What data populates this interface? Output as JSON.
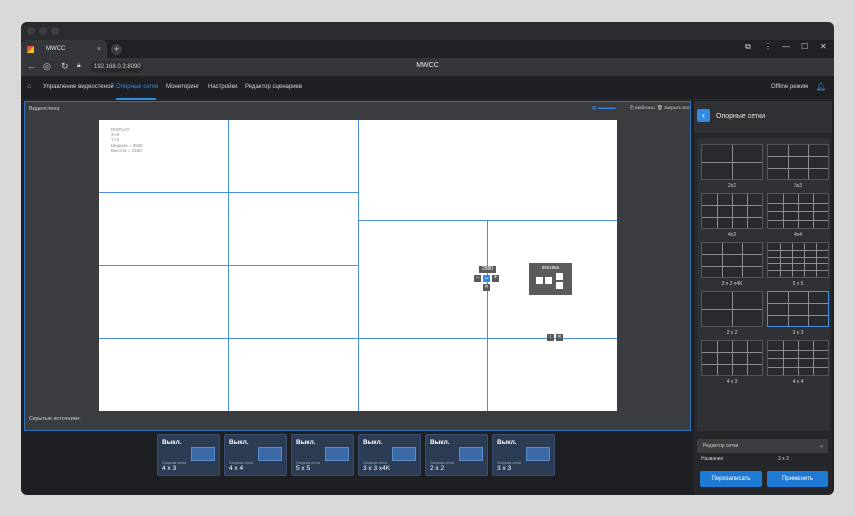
{
  "browser": {
    "tab_title": "MWCC",
    "new_tab": "+",
    "url": "192.168.0.3:8090",
    "app_title": "MWCC",
    "tab_close": "×",
    "controls": [
      "⧉",
      "⋮",
      "—",
      "☐",
      "✕"
    ]
  },
  "nav": {
    "items": [
      {
        "label": "Управление видеостеной",
        "active": false
      },
      {
        "label": "Опорные сетки",
        "active": true
      },
      {
        "label": "Мониторинг",
        "active": false
      },
      {
        "label": "Настройки",
        "active": false
      },
      {
        "label": "Редактор сценариев",
        "active": false
      }
    ],
    "offline_mode": "Offline режим"
  },
  "wall": {
    "label": "Видеостена",
    "hidden_sources": "Скрытые источники:",
    "tools": [
      "Шаблоны",
      "Закрыть все"
    ],
    "display_info": [
      "DISPLAY",
      "X=0",
      "Y=0",
      "Ширина = 3840",
      "Высота = 2160"
    ],
    "width_badge": "2880",
    "preview_label": "960x965"
  },
  "cards": [
    {
      "status": "Выкл.",
      "sub": "Опорная сетка",
      "name": "4 x 3"
    },
    {
      "status": "Выкл.",
      "sub": "Опорная сетка",
      "name": "4 x 4"
    },
    {
      "status": "Выкл.",
      "sub": "Опорная сетка",
      "name": "5 x 5"
    },
    {
      "status": "Выкл.",
      "sub": "Опорная сетка",
      "name": "3 x 3 x4K"
    },
    {
      "status": "Выкл.",
      "sub": "Опорная сетка",
      "name": "2 x 2"
    },
    {
      "status": "Выкл.",
      "sub": "Опорная сетка",
      "name": "3 x 3"
    }
  ],
  "panel": {
    "title": "Опорные сетки",
    "grids": [
      {
        "label": "2x2",
        "cols": 2,
        "rows": 2
      },
      {
        "label": "3x3",
        "cols": 3,
        "rows": 3
      },
      {
        "label": "4x3",
        "cols": 4,
        "rows": 3
      },
      {
        "label": "4x4",
        "cols": 4,
        "rows": 4
      },
      {
        "label": "3 x 3 x4K",
        "cols": 3,
        "rows": 3
      },
      {
        "label": "5 x 5",
        "cols": 5,
        "rows": 5
      },
      {
        "label": "2 x 2",
        "cols": 2,
        "rows": 2
      },
      {
        "label": "3 x 3",
        "cols": 3,
        "rows": 3,
        "selected": true
      },
      {
        "label": "4 x 3",
        "cols": 4,
        "rows": 3
      },
      {
        "label": "4 x 4",
        "cols": 4,
        "rows": 4
      }
    ],
    "editor_label": "Редактор сетки",
    "name_label": "Название",
    "name_value": "3 x 3",
    "overwrite_btn": "Перезаписать",
    "apply_btn": "Применить"
  }
}
